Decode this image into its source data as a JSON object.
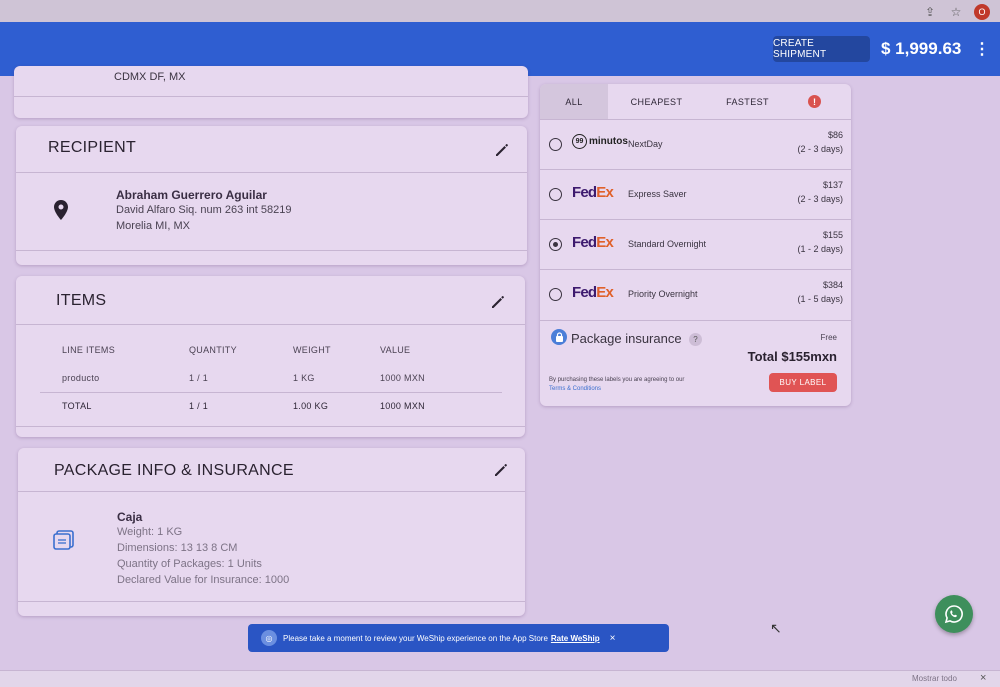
{
  "header": {
    "create_shipment_label": "CREATE SHIPMENT",
    "balance": "$ 1,999.63",
    "menu_icon": "more-vertical-icon"
  },
  "sender": {
    "city_line": "CDMX DF, MX"
  },
  "recipient": {
    "title": "RECIPIENT",
    "name": "Abraham Guerrero Aguilar",
    "address_line1": "David Alfaro Siq. num 263 int 58219",
    "address_line2": "Morelia MI, MX"
  },
  "items": {
    "title": "ITEMS",
    "columns": [
      "LINE ITEMS",
      "QUANTITY",
      "WEIGHT",
      "VALUE"
    ],
    "rows": [
      [
        "producto",
        "1 / 1",
        "1 KG",
        "1000 MXN"
      ]
    ],
    "total_row": [
      "TOTAL",
      "1 / 1",
      "1.00 KG",
      "1000 MXN"
    ]
  },
  "package": {
    "title": "PACKAGE INFO & INSURANCE",
    "name": "Caja",
    "weight": "Weight: 1 KG",
    "dimensions": "Dimensions: 13 13 8 CM",
    "quantity": "Quantity of Packages: 1 Units",
    "declared_value": "Declared Value for Insurance: 1000"
  },
  "rates": {
    "tabs": [
      "ALL",
      "CHEAPEST",
      "FASTEST"
    ],
    "active_tab": "ALL",
    "options": [
      {
        "carrier": "99minutos",
        "carrier_badge": "99",
        "carrier_suffix": "minutos",
        "service": "NextDay",
        "price": "$86",
        "days": "(2 - 3 days)",
        "selected": false
      },
      {
        "carrier": "FedEx",
        "fed": "Fed",
        "ex": "Ex",
        "service": "Express Saver",
        "price": "$137",
        "days": "(2 - 3 days)",
        "selected": false
      },
      {
        "carrier": "FedEx",
        "fed": "Fed",
        "ex": "Ex",
        "service": "Standard Overnight",
        "price": "$155",
        "days": "(1 - 2 days)",
        "selected": true
      },
      {
        "carrier": "FedEx",
        "fed": "Fed",
        "ex": "Ex",
        "service": "Priority Overnight",
        "price": "$384",
        "days": "(1 - 5 days)",
        "selected": false
      }
    ],
    "insurance_label": "Package insurance",
    "insurance_price": "Free",
    "total": "Total $155mxn",
    "disclaimer": "By purchasing these labels you are agreeing to our",
    "terms_link": "Terms & Conditions",
    "buy_label": "BUY LABEL"
  },
  "toast": {
    "message": "Please take a moment to review your WeShip experience on the App Store",
    "link": "Rate WeShip",
    "close": "×"
  },
  "bottom_bar": {
    "show_all": "Mostrar todo",
    "close": "×"
  },
  "colors": {
    "header_blue": "#2f5ed1",
    "fedex_purple": "#3d1a6e",
    "fedex_orange": "#e0612a",
    "buy_red": "#e05454",
    "whatsapp_green": "#3e8f5c"
  }
}
